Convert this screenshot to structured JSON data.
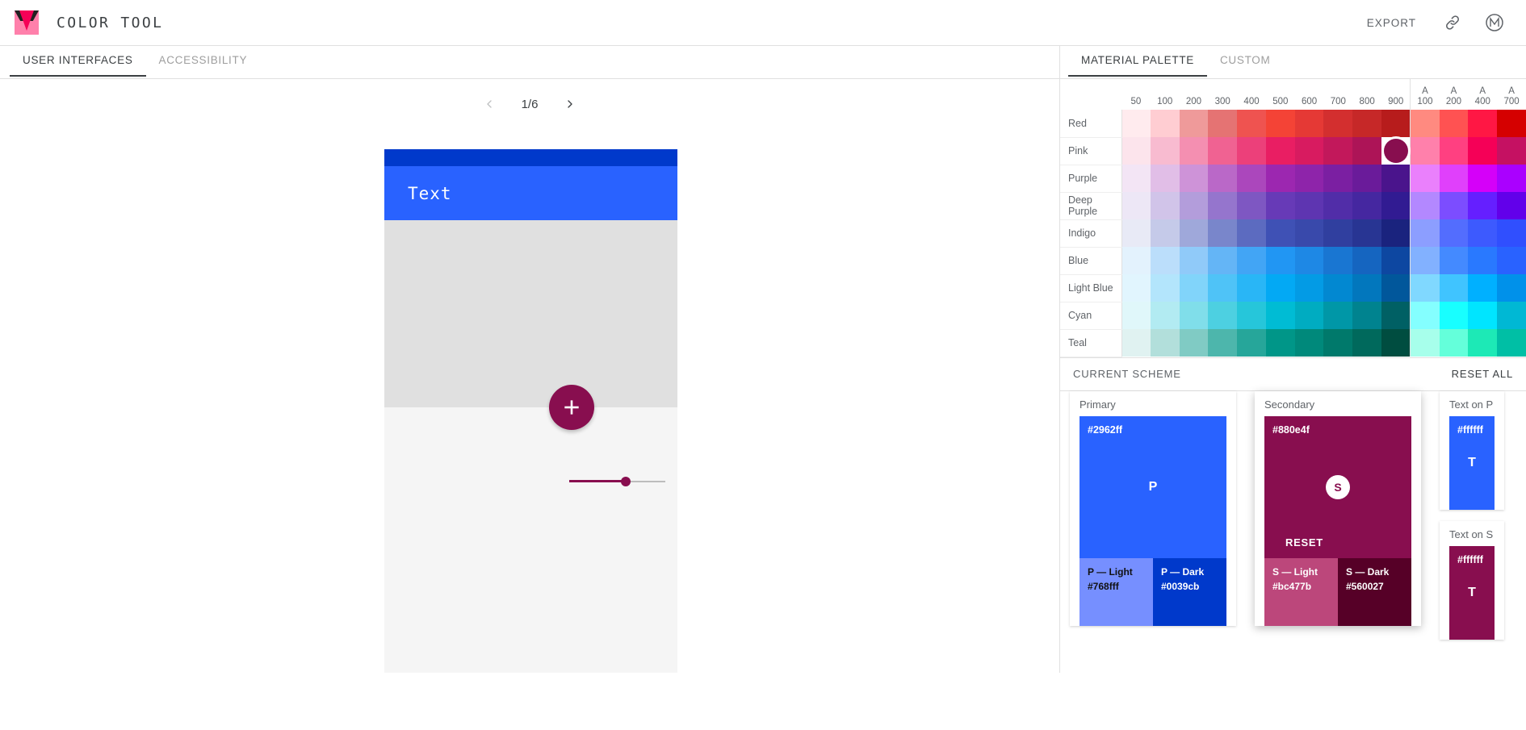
{
  "header": {
    "title": "COLOR TOOL",
    "logo_icon": "material-color-tool-logo",
    "export_label": "EXPORT",
    "link_icon": "link-icon",
    "material_icon": "material-design-icon"
  },
  "left": {
    "tabs": [
      {
        "label": "USER INTERFACES",
        "active": true
      },
      {
        "label": "ACCESSIBILITY",
        "active": false
      }
    ],
    "pager": {
      "prev_icon": "chevron-left-icon",
      "next_icon": "chevron-right-icon",
      "count": "1/6"
    },
    "preview": {
      "statusbar_color": "#0039cb",
      "appbar_color": "#2962ff",
      "appbar_title": "Text",
      "body_color": "#e0e0e0",
      "surface_color": "#f5f5f5",
      "fab_color": "#880e4f",
      "fab_icon": "plus-icon",
      "slider_color": "#880e4f",
      "slider_value": 59
    }
  },
  "right": {
    "tabs": [
      {
        "label": "MATERIAL PALETTE",
        "active": true
      },
      {
        "label": "CUSTOM",
        "active": false
      }
    ],
    "palette": {
      "columns": [
        "50",
        "100",
        "200",
        "300",
        "400",
        "500",
        "600",
        "700",
        "800",
        "900"
      ],
      "accent_columns": [
        {
          "top": "A",
          "bottom": "100"
        },
        {
          "top": "A",
          "bottom": "200"
        },
        {
          "top": "A",
          "bottom": "400"
        },
        {
          "top": "A",
          "bottom": "700"
        }
      ],
      "selected": {
        "row": "Pink",
        "column": "900",
        "hex": "#880e4f"
      },
      "rows": [
        {
          "name": "Red",
          "colors": [
            "#ffebee",
            "#ffcdd2",
            "#ef9a9a",
            "#e57373",
            "#ef5350",
            "#f44336",
            "#e53935",
            "#d32f2f",
            "#c62828",
            "#b71c1c",
            "#ff8a80",
            "#ff5252",
            "#ff1744",
            "#d50000"
          ]
        },
        {
          "name": "Pink",
          "colors": [
            "#fce4ec",
            "#f8bbd0",
            "#f48fb1",
            "#f06292",
            "#ec407a",
            "#e91e63",
            "#d81b60",
            "#c2185b",
            "#ad1457",
            "#880e4f",
            "#ff80ab",
            "#ff4081",
            "#f50057",
            "#c51162"
          ]
        },
        {
          "name": "Purple",
          "colors": [
            "#f3e5f5",
            "#e1bee7",
            "#ce93d8",
            "#ba68c8",
            "#ab47bc",
            "#9c27b0",
            "#8e24aa",
            "#7b1fa2",
            "#6a1b9a",
            "#4a148c",
            "#ea80fc",
            "#e040fb",
            "#d500f9",
            "#aa00ff"
          ]
        },
        {
          "name": "Deep Purple",
          "colors": [
            "#ede7f6",
            "#d1c4e9",
            "#b39ddb",
            "#9575cd",
            "#7e57c2",
            "#673ab7",
            "#5e35b1",
            "#512da8",
            "#4527a0",
            "#311b92",
            "#b388ff",
            "#7c4dff",
            "#651fff",
            "#6200ea"
          ]
        },
        {
          "name": "Indigo",
          "colors": [
            "#e8eaf6",
            "#c5cae9",
            "#9fa8da",
            "#7986cb",
            "#5c6bc0",
            "#3f51b5",
            "#3949ab",
            "#303f9f",
            "#283593",
            "#1a237e",
            "#8c9eff",
            "#536dfe",
            "#3d5afe",
            "#304ffe"
          ]
        },
        {
          "name": "Blue",
          "colors": [
            "#e3f2fd",
            "#bbdefb",
            "#90caf9",
            "#64b5f6",
            "#42a5f5",
            "#2196f3",
            "#1e88e5",
            "#1976d2",
            "#1565c0",
            "#0d47a1",
            "#82b1ff",
            "#448aff",
            "#2979ff",
            "#2962ff"
          ]
        },
        {
          "name": "Light Blue",
          "colors": [
            "#e1f5fe",
            "#b3e5fc",
            "#81d4fa",
            "#4fc3f7",
            "#29b6f6",
            "#03a9f4",
            "#039be5",
            "#0288d1",
            "#0277bd",
            "#01579b",
            "#80d8ff",
            "#40c4ff",
            "#00b0ff",
            "#0091ea"
          ]
        },
        {
          "name": "Cyan",
          "colors": [
            "#e0f7fa",
            "#b2ebf2",
            "#80deea",
            "#4dd0e1",
            "#26c6da",
            "#00bcd4",
            "#00acc1",
            "#0097a7",
            "#00838f",
            "#006064",
            "#84ffff",
            "#18ffff",
            "#00e5ff",
            "#00b8d4"
          ]
        },
        {
          "name": "Teal",
          "colors": [
            "#e0f2f1",
            "#b2dfdb",
            "#80cbc4",
            "#4db6ac",
            "#26a69a",
            "#009688",
            "#00897b",
            "#00796b",
            "#00695c",
            "#004d40",
            "#a7ffeb",
            "#64ffda",
            "#1de9b6",
            "#00bfa5"
          ]
        }
      ]
    },
    "scheme": {
      "title": "CURRENT SCHEME",
      "reset_all_label": "RESET ALL",
      "primary": {
        "label": "Primary",
        "hex": "#2962ff",
        "letter": "P",
        "light": {
          "label": "P — Light",
          "hex": "#768fff"
        },
        "dark": {
          "label": "P — Dark",
          "hex": "#0039cb"
        }
      },
      "secondary": {
        "label": "Secondary",
        "hex": "#880e4f",
        "letter": "S",
        "reset_label": "RESET",
        "light": {
          "label": "S — Light",
          "hex": "#bc477b"
        },
        "dark": {
          "label": "S — Dark",
          "hex": "#560027"
        }
      },
      "text_on_primary": {
        "label": "Text on P",
        "hex": "#ffffff",
        "letter": "T",
        "swatch_bg": "#2962ff"
      },
      "text_on_secondary": {
        "label": "Text on S",
        "hex": "#ffffff",
        "letter": "T",
        "swatch_bg": "#880e4f"
      }
    }
  }
}
